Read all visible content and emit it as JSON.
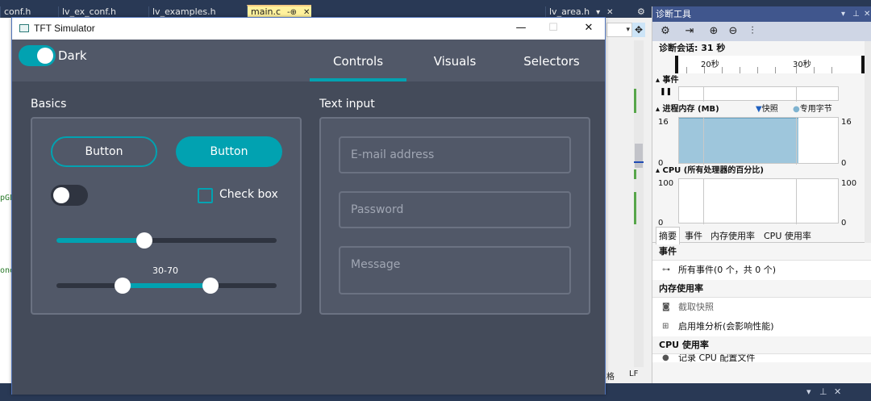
{
  "vs": {
    "tabs": [
      {
        "label": "conf.h"
      },
      {
        "label": "lv_ex_conf.h"
      },
      {
        "label": "lv_examples.h"
      },
      {
        "label": "main.c",
        "pin": "-⊕",
        "close": "✕"
      },
      {
        "label": "lv_area.h",
        "pin": "▾",
        "close": "✕"
      }
    ],
    "code_fragments": [
      "pGL",
      "one"
    ],
    "status_left": "格",
    "status_right": "LF"
  },
  "diag": {
    "title": "诊断工具",
    "session_label": "诊断会话: 31 秒",
    "timeline": {
      "tick1": "20秒",
      "tick2": "30秒"
    },
    "events_title": "事件",
    "memory_title": "进程内存 (MB)",
    "legend_snapshot": "快照",
    "legend_private": "专用字节",
    "memory_axis": {
      "top": "16",
      "bottom": "0"
    },
    "memory_fill_ratio": 0.75,
    "cpu_title": "CPU (所有处理器的百分比)",
    "cpu_axis": {
      "top": "100",
      "bottom": "0"
    },
    "tabs": [
      "摘要",
      "事件",
      "内存使用率",
      "CPU 使用率"
    ],
    "groups": {
      "events": "事件",
      "all_events": "所有事件(0 个，共 0 个)",
      "memory": "内存使用率",
      "take_snapshot": "截取快照",
      "heap_analysis": "启用堆分析(会影响性能)",
      "cpu": "CPU 使用率",
      "cpu_record": "记录 CPU 配置文件"
    },
    "colors": {
      "header": "#40568d",
      "memory_fill": "#9ec6dc"
    }
  },
  "sim": {
    "window_title": "TFT Simulator",
    "theme_label": "Dark",
    "tabs": [
      "Controls",
      "Visuals",
      "Selectors"
    ],
    "active_tab": "Controls",
    "basics": {
      "title": "Basics",
      "button_outline": "Button",
      "button_filled": "Button",
      "switch_on": false,
      "checkbox_label": "Check box",
      "checkbox_checked": false,
      "slider_value": 40,
      "range_min": 30,
      "range_max": 70,
      "range_label": "30-70"
    },
    "text_input": {
      "title": "Text input",
      "email_placeholder": "E-mail address",
      "password_placeholder": "Password",
      "message_placeholder": "Message"
    },
    "colors": {
      "accent": "#01a2b1",
      "background": "#444b5a",
      "panel": "#515868"
    }
  }
}
